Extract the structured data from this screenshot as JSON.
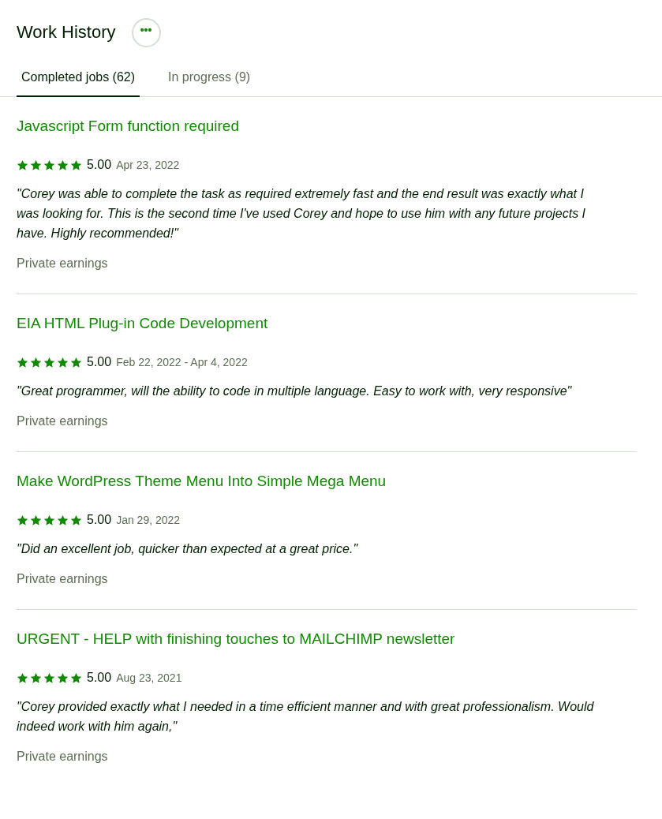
{
  "header": {
    "title": "Work History",
    "more_button": "•••"
  },
  "tabs": [
    {
      "label": "Completed jobs (62)",
      "selected": true
    },
    {
      "label": "In progress (9)",
      "selected": false
    }
  ],
  "jobs": [
    {
      "title": "Javascript Form function required",
      "stars": 5,
      "rating": "5.00",
      "dates": "Apr 23, 2022",
      "feedback": "\"Corey was able to complete the task as required extremely fast and the end result was exactly what I was looking for. This is the second time I've used Corey and hope to use him with any future projects I have. Highly recommended!\"",
      "earnings": "Private earnings"
    },
    {
      "title": "EIA HTML Plug-in Code Development",
      "stars": 5,
      "rating": "5.00",
      "dates": "Feb 22, 2022 - Apr 4, 2022",
      "feedback": "\"Great programmer, will the ability to code in multiple language. Easy to work with, very responsive\"",
      "earnings": "Private earnings"
    },
    {
      "title": "Make WordPress Theme Menu Into Simple Mega Menu",
      "stars": 5,
      "rating": "5.00",
      "dates": "Jan 29, 2022",
      "feedback": "\"Did an excellent job, quicker than expected at a great price.\"",
      "earnings": "Private earnings"
    },
    {
      "title": "URGENT - HELP with finishing touches to MAILCHIMP newsletter",
      "stars": 5,
      "rating": "5.00",
      "dates": "Aug 23, 2021",
      "feedback": "\"Corey provided exactly what I needed in a time efficient manner and with great professionalism. Would indeed work with him again,\"",
      "earnings": "Private earnings"
    }
  ]
}
